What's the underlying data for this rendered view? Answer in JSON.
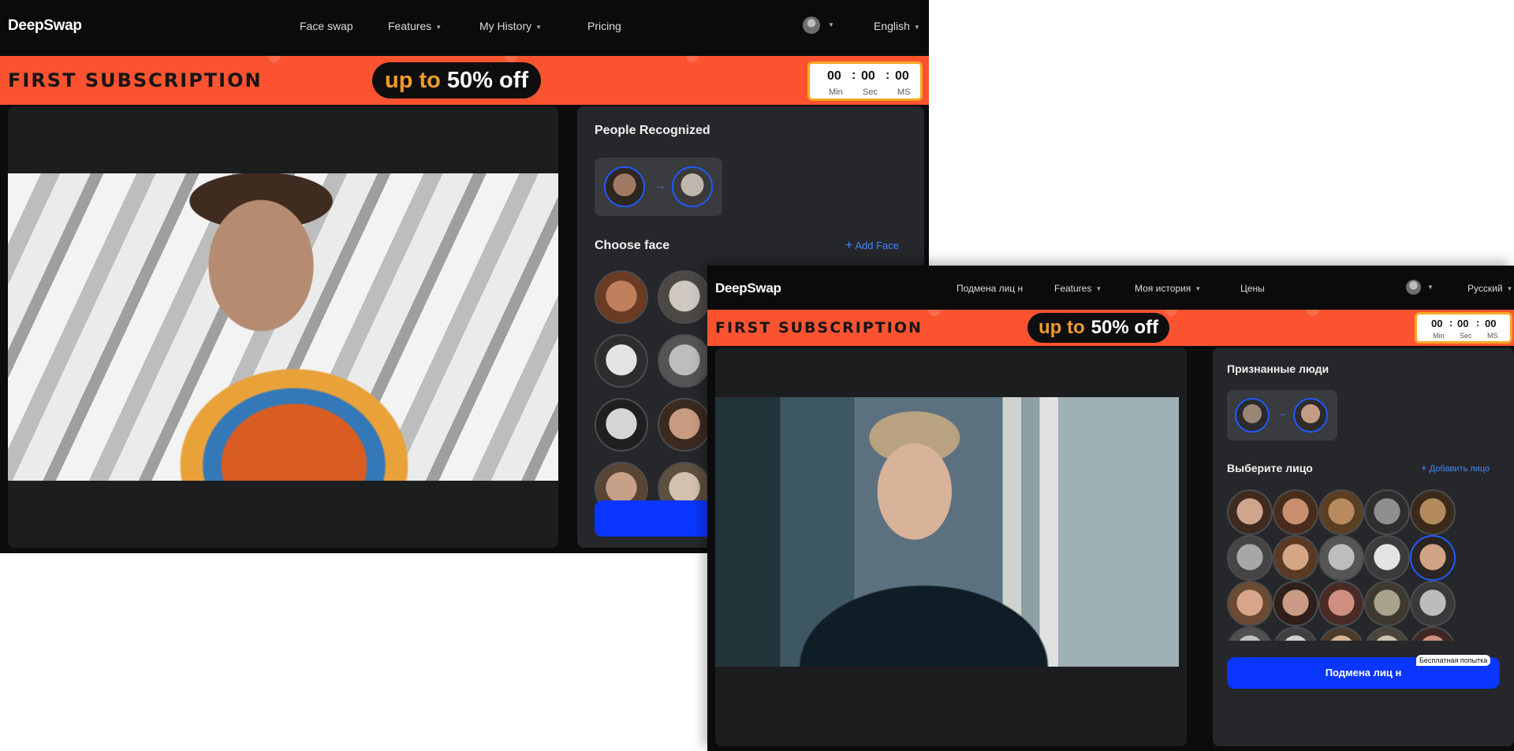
{
  "english_window": {
    "nav": {
      "logo": "DeepSwap",
      "items": [
        "Face swap",
        "Features",
        "My History",
        "Pricing"
      ],
      "language": "English"
    },
    "banner": {
      "title": "FIRST SUBSCRIPTION",
      "promo_prefix": "up to",
      "promo_value": "50% off",
      "timer": {
        "min": "00",
        "sec": "00",
        "ms": "00",
        "labels": [
          "Min",
          "Sec",
          "MS"
        ]
      }
    },
    "panel": {
      "people_recognized": "People Recognized",
      "choose_face": "Choose face",
      "add_face": "Add Face",
      "arrow": "→"
    }
  },
  "russian_window": {
    "nav": {
      "logo": "DeepSwap",
      "items": [
        "Подмена лиц н",
        "Features",
        "Моя история",
        "Цены"
      ],
      "language": "Русский"
    },
    "banner": {
      "title": "FIRST SUBSCRIPTION",
      "promo_prefix": "up to",
      "promo_value": "50% off",
      "timer": {
        "min": "00",
        "sec": "00",
        "ms": "00",
        "labels": [
          "Min",
          "Sec",
          "MS"
        ]
      }
    },
    "panel": {
      "people_recognized": "Признанные люди",
      "choose_face": "Выберите лицо",
      "add_face": "Добавить лицо",
      "arrow": "→",
      "swap_button": "Подмена лиц н",
      "free_badge": "Бесплатная попытка"
    }
  },
  "colors": {
    "banner": "#fb5330",
    "accent_blue": "#0a36ff",
    "link_blue": "#3e86ff",
    "promo_orange": "#f29a2d",
    "timer_border": "#f6a623"
  },
  "icons": [
    "user-avatar-icon",
    "chevron-down-icon",
    "plus-icon",
    "arrow-right-icon"
  ]
}
